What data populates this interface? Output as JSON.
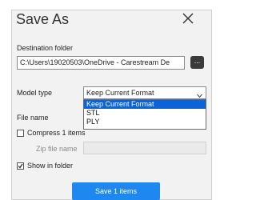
{
  "dialog": {
    "title": "Save As",
    "destination_label": "Destination folder",
    "destination_value": "C:\\Users\\19020503\\OneDrive - Carestream De",
    "browse_label": "...",
    "model_type_label": "Model type",
    "model_type_selected": "Keep Current Format",
    "model_type_options": [
      "Keep Current Format",
      "STL",
      "PLY"
    ],
    "file_name_label": "File name",
    "compress_label": "Compress 1 items",
    "zip_label": "Zip file name",
    "show_in_folder_label": "Show in folder",
    "save_label": "Save 1 items"
  },
  "colors": {
    "accent": "#1e87f0",
    "selected_option": "#0b63d9"
  }
}
